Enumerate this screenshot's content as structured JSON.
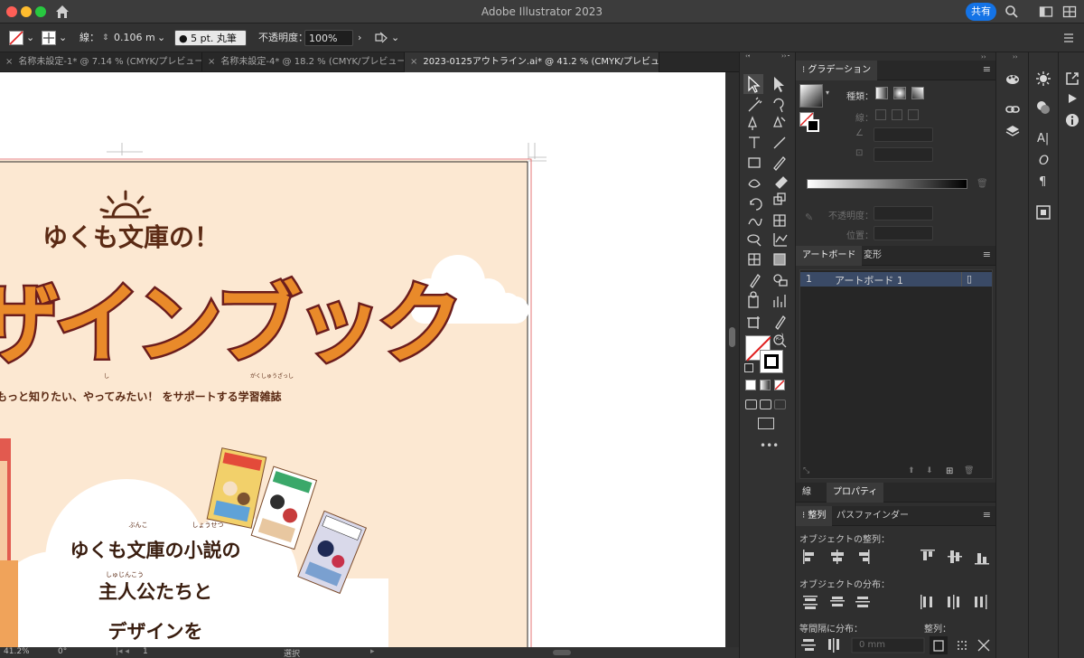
{
  "window": {
    "title": "Adobe Illustrator 2023",
    "share_label": "共有"
  },
  "controlbar": {
    "stroke_label": "線：",
    "stroke_value": "0.106 m",
    "brush_value": "5 pt. 丸筆",
    "opacity_label": "不透明度：",
    "opacity_value": "100%"
  },
  "tabs": [
    {
      "label": "名称未設定-1* @ 7.14 % (CMYK/プレビュー)",
      "active": false
    },
    {
      "label": "名称未設定-4* @ 18.2 % (CMYK/プレビュー)",
      "active": false
    },
    {
      "label": "2023-0125アウトライン.ai* @ 41.2 % (CMYK/プレビュー)",
      "active": true
    }
  ],
  "artboard": {
    "kicker": "ゆくも文庫の！",
    "headline": "ザインブック",
    "tagline": "もっと知りたい、やってみたい！ をサポートする学習雑誌",
    "furigana": {
      "shi": "し",
      "gakushuuzasshi": "がくしゅうざっし",
      "bunko": "ぶんこ",
      "shousetsu": "しょうせつ",
      "shujinkou": "しゅじんこう"
    },
    "cloud_lines": [
      "ゆくも文庫の小説の",
      "主人公たちと",
      "デザインを"
    ],
    "colors": {
      "bg": "#fce8d2",
      "brown": "#5b2a14",
      "red": "#c9333d",
      "orange": "#e98a2a",
      "outline": "#6b1d1d"
    }
  },
  "statusbar": {
    "zoom": "41.2%",
    "angle": "0°",
    "page": "1",
    "mode": "選択"
  },
  "gradient_panel": {
    "title": "グラデーション",
    "type_label": "種類：",
    "stroke_label": "線：",
    "opacity_label": "不透明度：",
    "position_label": "位置："
  },
  "artboards_panel": {
    "tabs": [
      "アートボード",
      "変形"
    ],
    "rows": [
      {
        "index": "1",
        "name": "アートボード 1"
      }
    ]
  },
  "properties_tabs": [
    "線",
    "プロパティ"
  ],
  "align_panel": {
    "tabs": [
      "整列",
      "パスファインダー"
    ],
    "align_objects_label": "オブジェクトの整列：",
    "distribute_objects_label": "オブジェクトの分布：",
    "distribute_spacing_label": "等間隔に分布：",
    "align_to_label": "整列：",
    "spacing_value": "0 mm"
  }
}
